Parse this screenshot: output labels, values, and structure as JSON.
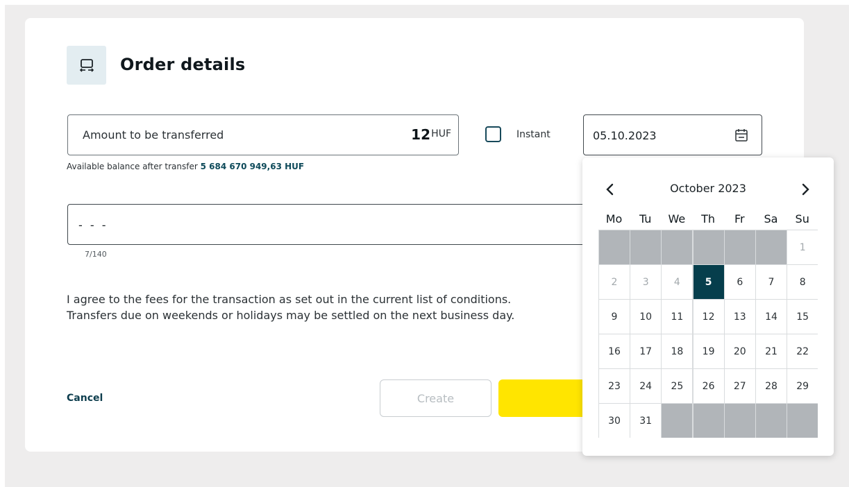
{
  "form": {
    "title": "Order details",
    "amount_label": "Amount to be transferred",
    "amount_value": "12",
    "currency": "HUF",
    "balance_prefix": "Available balance after transfer",
    "balance_value": "5 684 670 949,63 HUF",
    "instant_label": "Instant",
    "instant_checked": false,
    "date_value": "05.10.2023",
    "message_value": "- - -",
    "message_counter": "7/140",
    "agree_line1": "I agree to the fees for the transaction as set out in the current list of conditions.",
    "agree_line2": "Transfers due on weekends or holidays may be settled on the next business day.",
    "cancel_label": "Cancel",
    "create_label": "Create"
  },
  "calendar": {
    "month_label": "October 2023",
    "weekdays": [
      "Mo",
      "Tu",
      "We",
      "Th",
      "Fr",
      "Sa",
      "Su"
    ],
    "selected_day": "5",
    "leading_empty": 6,
    "days_in_month": 31,
    "past_days": [
      "1",
      "2",
      "3",
      "4"
    ]
  },
  "colors": {
    "accent": "#063e4c",
    "primary_button": "#ffe500",
    "link": "#0e3e4e"
  }
}
